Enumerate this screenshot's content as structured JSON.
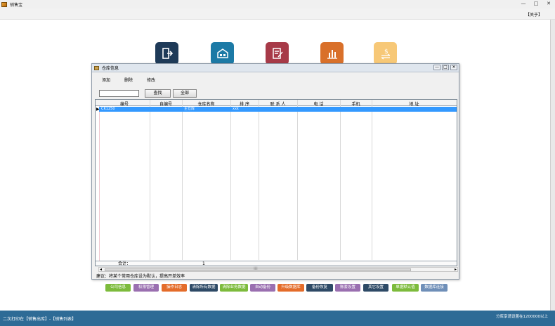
{
  "window": {
    "title": "销售宝",
    "controls": [
      "—",
      "□",
      "✕"
    ]
  },
  "menu": {
    "about": "【关于】"
  },
  "tiles": [
    {
      "icon": "exit-door-icon",
      "color": "#1e3a58"
    },
    {
      "icon": "warehouse-icon",
      "color": "#1c7aa6"
    },
    {
      "icon": "edit-document-icon",
      "color": "#a73a48"
    },
    {
      "icon": "bar-chart-icon",
      "color": "#d9702a"
    },
    {
      "icon": "dollar-transfer-icon",
      "color": "#f7c877"
    }
  ],
  "dialog": {
    "title": "仓库信息",
    "controls": [
      "—",
      "□",
      "✕"
    ],
    "toolbar": {
      "add": "添加",
      "delete": "删除",
      "edit": "修改"
    },
    "search": {
      "value": "",
      "placeholder": ""
    },
    "find_button": "查找",
    "all_button": "全部",
    "columns": [
      "编号",
      "自编号",
      "仓库名称",
      "排  序",
      "联 系 人",
      "电   话",
      "手机",
      "地     址"
    ],
    "rows": [
      {
        "id": "CK1250",
        "self_id": "",
        "name": "主仓库",
        "sort": "xxk",
        "contact": "",
        "phone": "",
        "mobile": "",
        "address": ""
      }
    ],
    "total_label": "合计：",
    "total_value": "1",
    "tip": "建议：将某个常用仓库设为默认，提高开单效率"
  },
  "buttons": [
    {
      "label": "公司信息",
      "color": "#7dbb3c"
    },
    {
      "label": "权限管理",
      "color": "#9a6fb0"
    },
    {
      "label": "操作日志",
      "color": "#e46c2a"
    },
    {
      "label": "清除所有数据",
      "color": "#2e4a66"
    },
    {
      "label": "清除业务数据",
      "color": "#7dbb3c"
    },
    {
      "label": "自动备份",
      "color": "#9a6fb0"
    },
    {
      "label": "升级数据库",
      "color": "#e46c2a"
    },
    {
      "label": "备份恢复",
      "color": "#2e4a66"
    },
    {
      "label": "账套设置",
      "color": "#9a6fb0"
    },
    {
      "label": "其它设置",
      "color": "#2e4a66"
    },
    {
      "label": "单据默认值",
      "color": "#7dbb3c"
    },
    {
      "label": "数据库连接",
      "color": "#6f8fb8"
    }
  ],
  "footer": {
    "left": "二次打印在【销售出库】-【销售列表】",
    "right": "分库享请设置在1200000以上"
  }
}
